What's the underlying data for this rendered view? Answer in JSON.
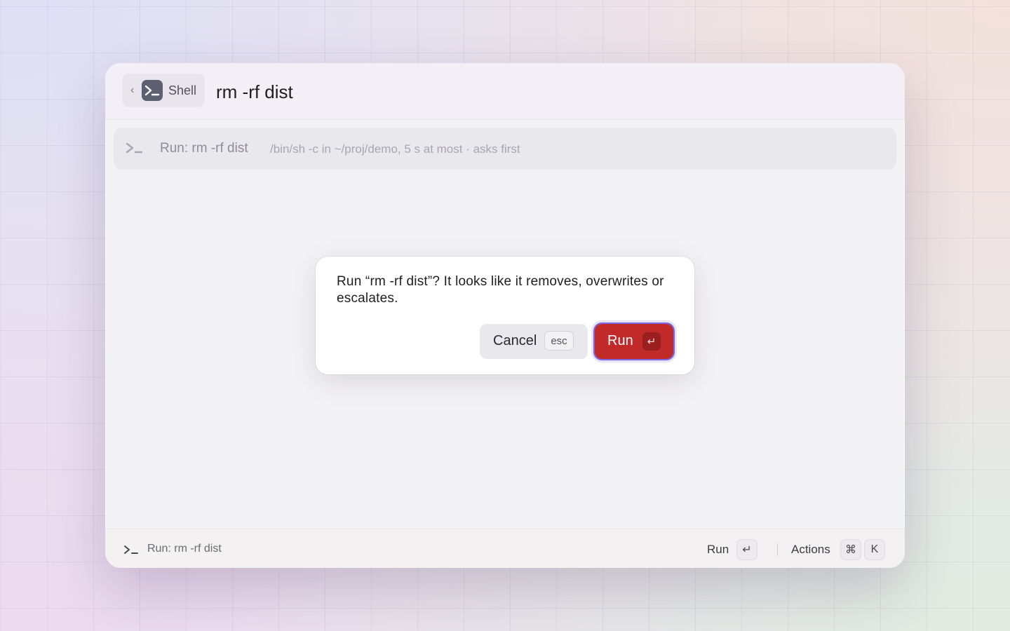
{
  "header": {
    "back_chevron": "‹",
    "extension_icon": "terminal-icon",
    "extension_name": "Shell",
    "query": "rm -rf dist"
  },
  "list": {
    "items": [
      {
        "icon": "terminal-prompt-icon",
        "title": "Run: rm -rf dist",
        "subtitle": "/bin/sh -c in ~/proj/demo, 5 s at most · asks first"
      }
    ]
  },
  "dialog": {
    "message": "Run “rm -rf dist”? It looks like it removes, overwrites or escalates.",
    "cancel": {
      "label": "Cancel",
      "shortcut": "esc"
    },
    "confirm": {
      "label": "Run",
      "shortcut": "↵"
    }
  },
  "footer": {
    "icon": "terminal-prompt-icon",
    "title": "Run: rm -rf dist",
    "primary_action": {
      "label": "Run",
      "shortcut": "↵"
    },
    "actions": {
      "label": "Actions",
      "shortcut_mod": "⌘",
      "shortcut_key": "K"
    }
  },
  "colors": {
    "danger": "#c22a2a",
    "focus_ring": "#7a67e6",
    "icon_tile": "#5c6070"
  }
}
